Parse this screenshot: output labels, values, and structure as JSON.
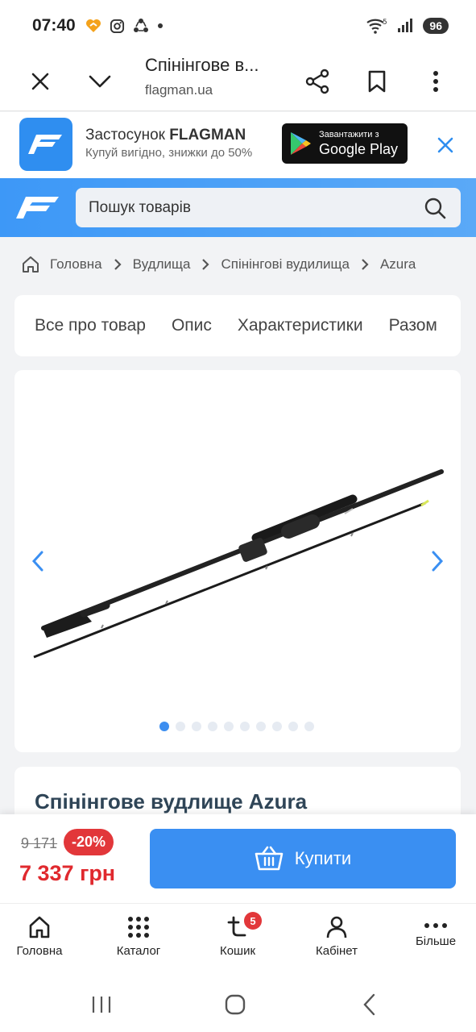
{
  "status": {
    "time": "07:40",
    "battery": "96",
    "signal_label": "5"
  },
  "browser": {
    "title": "Спінінгове в...",
    "url": "flagman.ua"
  },
  "app_banner": {
    "title_prefix": "Застосунок ",
    "title_brand": "FLAGMAN",
    "subtitle": "Купуй вигідно, знижки до 50%",
    "store_line1": "Завантажити з",
    "store_line2": "Google Play"
  },
  "search": {
    "placeholder": "Пошук товарів"
  },
  "breadcrumb": [
    "Головна",
    "Вудлища",
    "Спінінгові вудилища",
    "Azura"
  ],
  "tabs": [
    "Все про товар",
    "Опис",
    "Характеристики",
    "Разом"
  ],
  "gallery": {
    "total_slides": 10,
    "active_slide": 1
  },
  "product": {
    "title": "Спінінгове вудлище Azura"
  },
  "price": {
    "old": "9 171",
    "discount": "-20%",
    "current": "7 337 грн"
  },
  "buy_button": {
    "label": "Купити"
  },
  "bottom_nav": {
    "home": "Головна",
    "catalog": "Каталог",
    "cart": "Кошик",
    "cart_count": "5",
    "account": "Кабінет",
    "more": "Більше"
  },
  "colors": {
    "accent": "#3a8ff2",
    "price_red": "#e0292e",
    "title_dark": "#2f4557"
  }
}
